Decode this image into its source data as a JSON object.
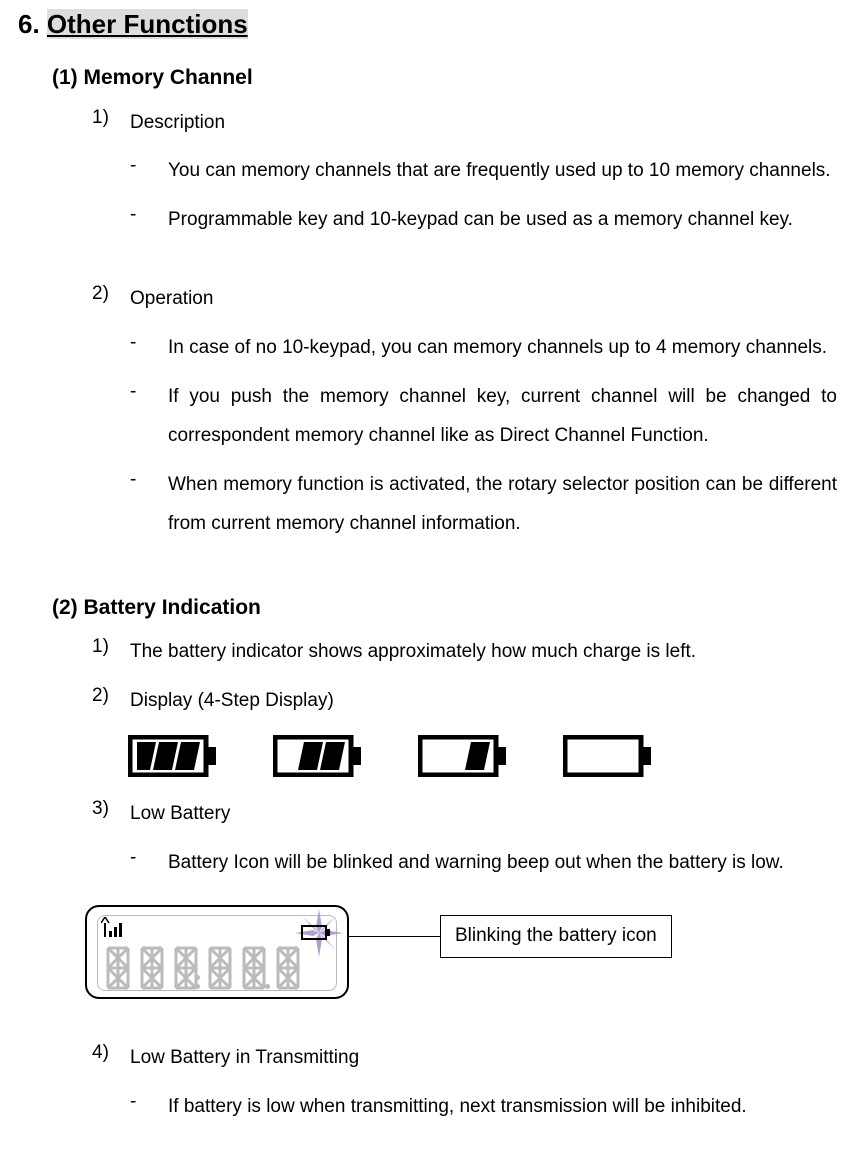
{
  "section": {
    "number": "6.",
    "title": "Other Functions"
  },
  "sub1": {
    "heading": "(1) Memory Channel",
    "item1": {
      "num": "1)",
      "label": "Description"
    },
    "item1_b1": "You can memory channels that are frequently used up to 10 memory channels.",
    "item1_b2": "Programmable key and 10-keypad can be used as a memory channel key.",
    "item2": {
      "num": "2)",
      "label": "Operation"
    },
    "item2_b1": "In case of no 10-keypad, you can memory channels up to 4 memory channels.",
    "item2_b2": "If you push the memory channel key, current channel will be changed to correspondent memory channel like as Direct Channel Function.",
    "item2_b3": "When memory function is activated, the rotary selector position can be different from current memory channel information."
  },
  "sub2": {
    "heading": "(2) Battery Indication",
    "item1": {
      "num": "1)",
      "label": "The battery indicator shows approximately how much charge is left."
    },
    "item2": {
      "num": "2)",
      "label": "Display (4-Step Display)"
    },
    "item3": {
      "num": "3)",
      "label": "Low Battery"
    },
    "item3_b1": "Battery Icon will be blinked and warning beep out when the battery is low.",
    "callout": "Blinking the battery icon",
    "item4": {
      "num": "4)",
      "label": "Low Battery in Transmitting"
    },
    "item4_b1": "If battery is low when transmitting, next transmission will be inhibited."
  }
}
